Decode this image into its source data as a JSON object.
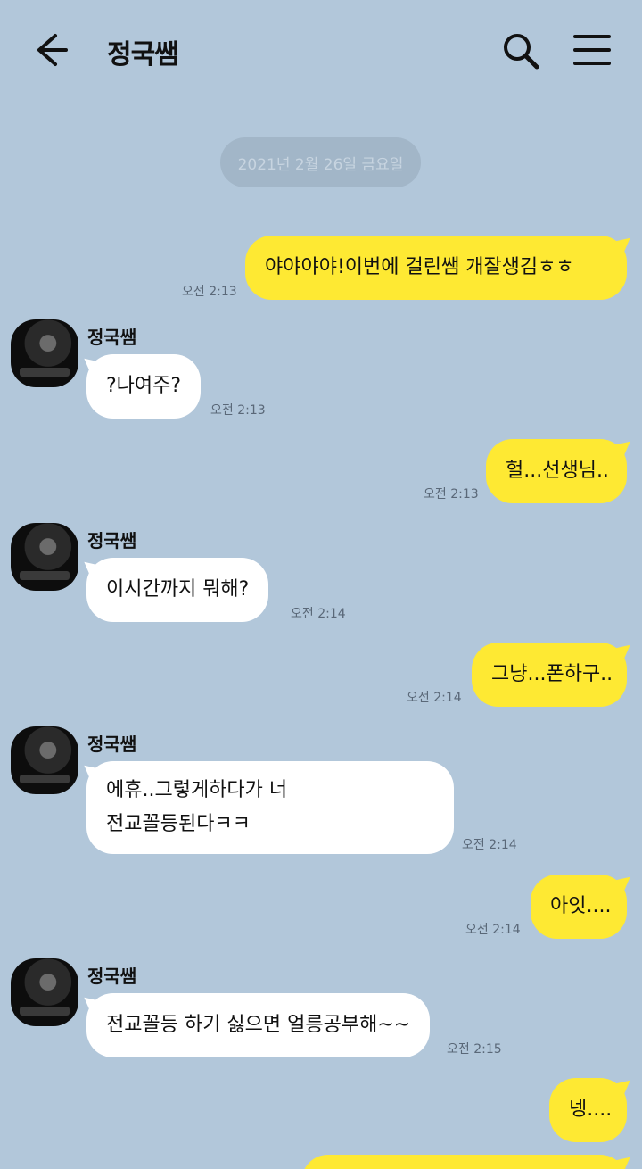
{
  "header": {
    "title": "정국쌤",
    "back_icon": "back-arrow-icon",
    "search_icon": "search-icon",
    "menu_icon": "hamburger-menu-icon"
  },
  "date_divider": "2021년 2월 26일 금요일",
  "colors": {
    "background": "#b2c7da",
    "my_bubble": "#fee933",
    "their_bubble": "#ffffff"
  },
  "messages": [
    {
      "from": "me",
      "text": "야야야야!이번에 걸린쌤 개잘생김ㅎㅎ",
      "time": "오전 2:13"
    },
    {
      "from": "them",
      "sender": "정국쌤",
      "text": "?나여주?",
      "time": "오전 2:13"
    },
    {
      "from": "me",
      "text": "헐...선생님..",
      "time": "오전 2:13"
    },
    {
      "from": "them",
      "sender": "정국쌤",
      "text": "이시간까지 뭐해?",
      "time": "오전 2:14"
    },
    {
      "from": "me",
      "text": "그냥...폰하구..",
      "time": "오전 2:14"
    },
    {
      "from": "them",
      "sender": "정국쌤",
      "lines": [
        "에휴..그렇게하다가 너",
        "전교꼴등된다ㅋㅋ"
      ],
      "time": "오전 2:14"
    },
    {
      "from": "me",
      "text": "아잇....",
      "time": "오전 2:14"
    },
    {
      "from": "them",
      "sender": "정국쌤",
      "text": "전교꼴등 하기 싫으면 얼릉공부해~~",
      "time": "오전 2:15"
    },
    {
      "from": "me",
      "text": "넹....",
      "time": ""
    }
  ]
}
